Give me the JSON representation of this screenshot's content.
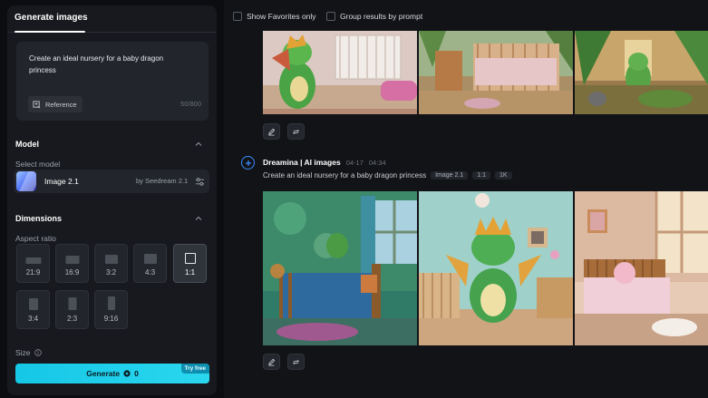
{
  "panel": {
    "tab_label": "Generate images",
    "prompt_text": "Create an ideal nursery for a baby dragon princess",
    "reference_label": "Reference",
    "char_count": "50/800"
  },
  "model": {
    "section_title": "Model",
    "select_label": "Select model",
    "name": "Image 2.1",
    "by": "by Seedream 2.1"
  },
  "dimensions": {
    "section_title": "Dimensions",
    "aspect_label": "Aspect ratio",
    "ratios": [
      "21:9",
      "16:9",
      "3:2",
      "4:3",
      "1:1",
      "3:4",
      "2:3",
      "9:16"
    ],
    "selected": "1:1",
    "size_label": "Size"
  },
  "generate": {
    "label": "Generate",
    "credits": "0",
    "badge": "Try free",
    "color": "#1fcfe9"
  },
  "filters": {
    "favorites_label": "Show Favorites only",
    "group_label": "Group results by prompt"
  },
  "result": {
    "title": "Dreamina | AI images",
    "date": "04-17",
    "time": "04:34",
    "prompt": "Create an ideal nursery for a baby dragon princess",
    "chips": [
      "Image 2.1",
      "1:1",
      "1K"
    ]
  },
  "icons": [
    "reference-icon",
    "chevron-up-icon",
    "tune-icon",
    "info-icon",
    "credit-icon",
    "edit-icon",
    "regenerate-icon",
    "generation-icon"
  ]
}
